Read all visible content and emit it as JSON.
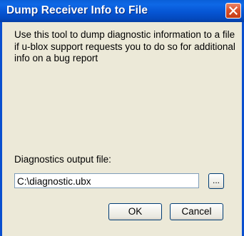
{
  "window": {
    "title": "Dump Receiver Info to File"
  },
  "description": "Use this tool to dump diagnostic information to a file if u-blox support requests you to do so for additional info on a bug report",
  "output": {
    "label": "Diagnostics output file:",
    "value": "C:\\diagnostic.ubx",
    "browse_label": "..."
  },
  "buttons": {
    "ok_label": "OK",
    "cancel_label": "Cancel"
  },
  "colors": {
    "titlebar": "#0655d4",
    "close": "#d9512c",
    "background": "#ece9d8"
  },
  "icons": {
    "close": "close-icon"
  }
}
